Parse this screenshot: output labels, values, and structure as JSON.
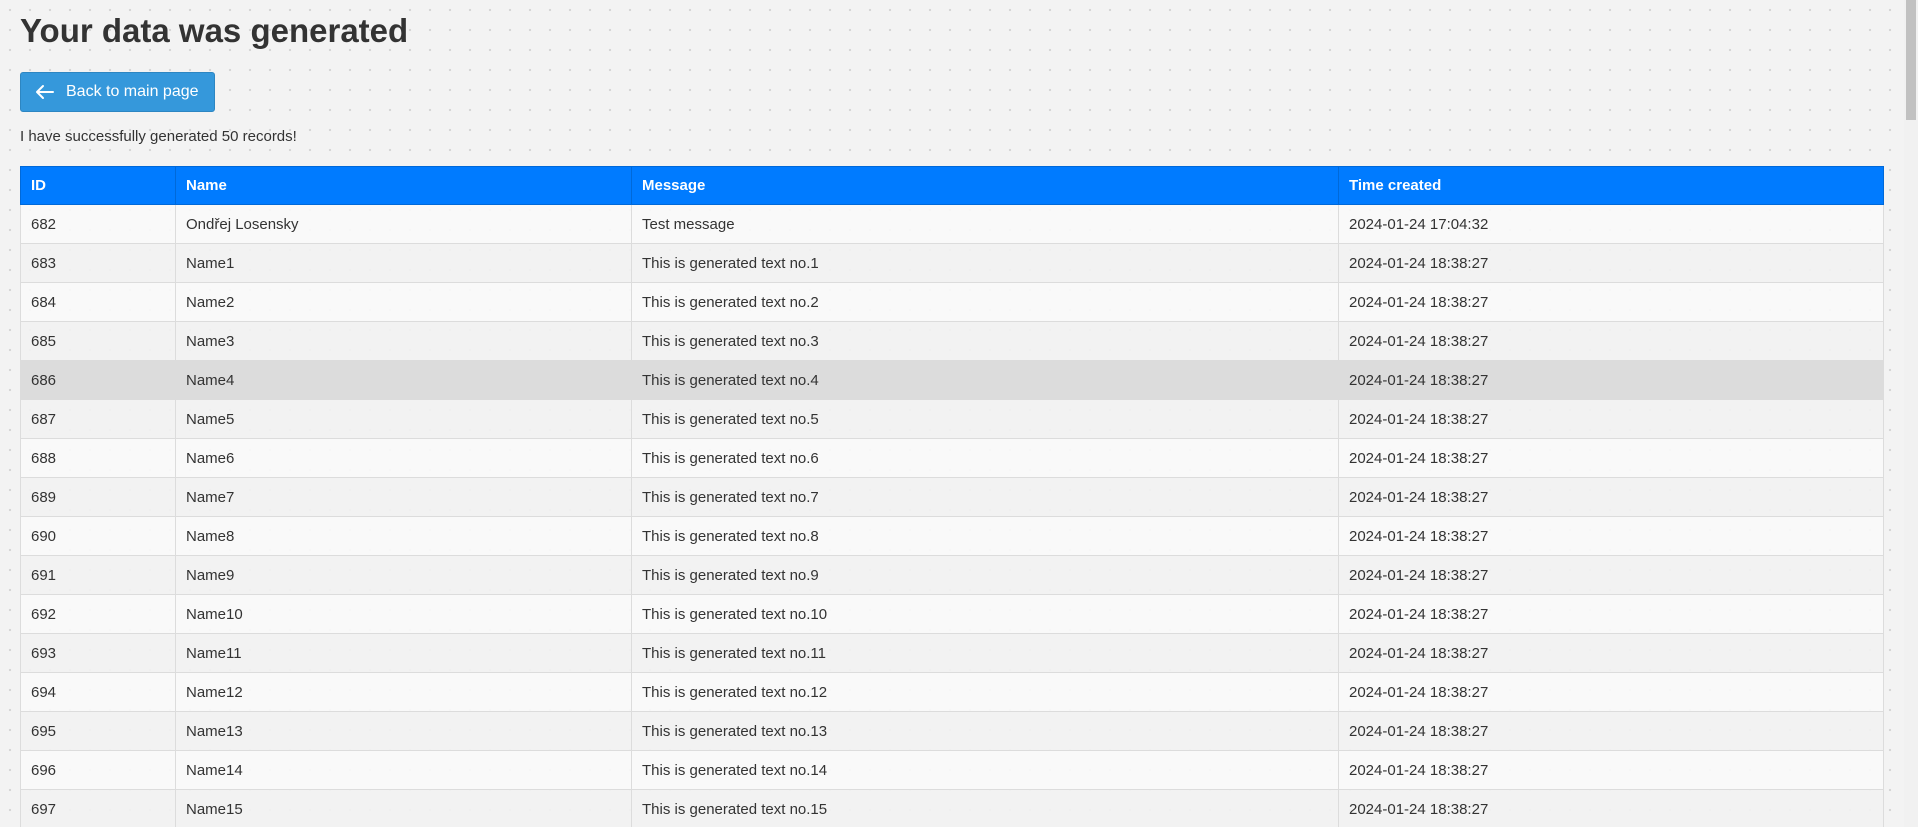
{
  "page": {
    "title": "Your data was generated",
    "back_button_label": "Back to main page",
    "status_message": "I have successfully generated 50 records!"
  },
  "table": {
    "columns": [
      "ID",
      "Name",
      "Message",
      "Time created"
    ],
    "rows": [
      {
        "id": "682",
        "name": "Ondřej Losensky",
        "message": "Test message",
        "time": "2024-01-24 17:04:32"
      },
      {
        "id": "683",
        "name": "Name1",
        "message": "This is generated text no.1",
        "time": "2024-01-24 18:38:27"
      },
      {
        "id": "684",
        "name": "Name2",
        "message": "This is generated text no.2",
        "time": "2024-01-24 18:38:27"
      },
      {
        "id": "685",
        "name": "Name3",
        "message": "This is generated text no.3",
        "time": "2024-01-24 18:38:27"
      },
      {
        "id": "686",
        "name": "Name4",
        "message": "This is generated text no.4",
        "time": "2024-01-24 18:38:27"
      },
      {
        "id": "687",
        "name": "Name5",
        "message": "This is generated text no.5",
        "time": "2024-01-24 18:38:27"
      },
      {
        "id": "688",
        "name": "Name6",
        "message": "This is generated text no.6",
        "time": "2024-01-24 18:38:27"
      },
      {
        "id": "689",
        "name": "Name7",
        "message": "This is generated text no.7",
        "time": "2024-01-24 18:38:27"
      },
      {
        "id": "690",
        "name": "Name8",
        "message": "This is generated text no.8",
        "time": "2024-01-24 18:38:27"
      },
      {
        "id": "691",
        "name": "Name9",
        "message": "This is generated text no.9",
        "time": "2024-01-24 18:38:27"
      },
      {
        "id": "692",
        "name": "Name10",
        "message": "This is generated text no.10",
        "time": "2024-01-24 18:38:27"
      },
      {
        "id": "693",
        "name": "Name11",
        "message": "This is generated text no.11",
        "time": "2024-01-24 18:38:27"
      },
      {
        "id": "694",
        "name": "Name12",
        "message": "This is generated text no.12",
        "time": "2024-01-24 18:38:27"
      },
      {
        "id": "695",
        "name": "Name13",
        "message": "This is generated text no.13",
        "time": "2024-01-24 18:38:27"
      },
      {
        "id": "696",
        "name": "Name14",
        "message": "This is generated text no.14",
        "time": "2024-01-24 18:38:27"
      },
      {
        "id": "697",
        "name": "Name15",
        "message": "This is generated text no.15",
        "time": "2024-01-24 18:38:27"
      }
    ]
  },
  "colors": {
    "button": "#3598db",
    "table_header": "#007bff",
    "hover_row": "#dcdcdc"
  },
  "icons": {
    "back": "arrow-left-icon"
  }
}
